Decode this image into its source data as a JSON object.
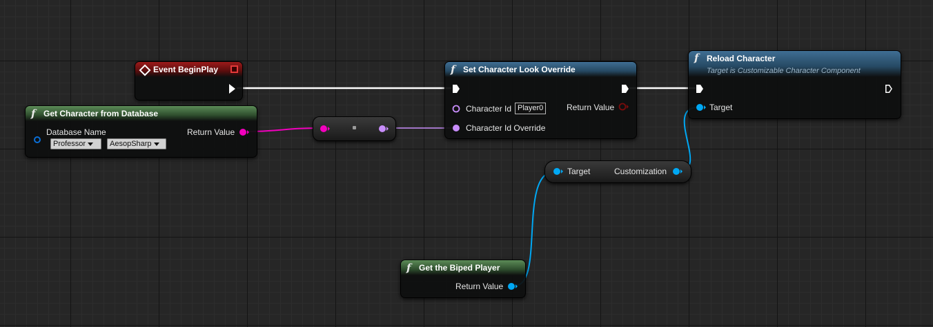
{
  "colors": {
    "exec_wire": "#ffffff",
    "string_pin": "#f300be",
    "name_pin": "#c88dfb",
    "object_pin": "#00a8f4",
    "event_header": "#9c1b1b",
    "pure_header": "#5b8b57",
    "function_header": "#3f6e93"
  },
  "nodes": {
    "event_begin_play": {
      "title": "Event BeginPlay",
      "icon": "event-diamond-icon"
    },
    "get_character_from_database": {
      "title": "Get Character from Database",
      "icon": "function-icon",
      "input_label": "Database Name",
      "dropdown_1": "Professor",
      "dropdown_2": "AesopSharp",
      "output_label": "Return Value"
    },
    "set_character_look_override": {
      "title": "Set Character Look Override",
      "icon": "function-icon",
      "pin_character_id": "Character Id",
      "character_id_value": "Player0",
      "pin_character_id_override": "Character Id Override",
      "output_label": "Return Value"
    },
    "reload_character": {
      "title": "Reload Character",
      "subtitle": "Target is Customizable Character Component",
      "icon": "function-icon",
      "pin_target": "Target"
    },
    "customization_getter": {
      "pin_target": "Target",
      "output_label": "Customization"
    },
    "get_the_biped_player": {
      "title": "Get the Biped Player",
      "icon": "function-icon",
      "output_label": "Return Value"
    }
  }
}
